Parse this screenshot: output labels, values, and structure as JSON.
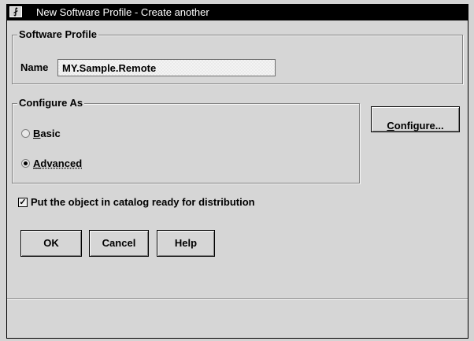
{
  "window": {
    "title": "New Software Profile - Create another",
    "sysmenu_icon": "minimize-arrow-icon"
  },
  "software_profile": {
    "group_label": "Software Profile",
    "name_label": "Name",
    "name_value": "MY.Sample.Remote"
  },
  "configure_as": {
    "group_label": "Configure As",
    "options": [
      {
        "first": "B",
        "rest": "asic",
        "selected": false
      },
      {
        "first": "A",
        "rest": "dvanced",
        "selected": true
      }
    ],
    "configure_button": {
      "first": "C",
      "rest": "onfigure..."
    }
  },
  "catalog_checkbox": {
    "label": "Put the object in catalog ready for distribution",
    "checked": true
  },
  "buttons": {
    "ok": "OK",
    "cancel": "Cancel",
    "help": "Help"
  }
}
